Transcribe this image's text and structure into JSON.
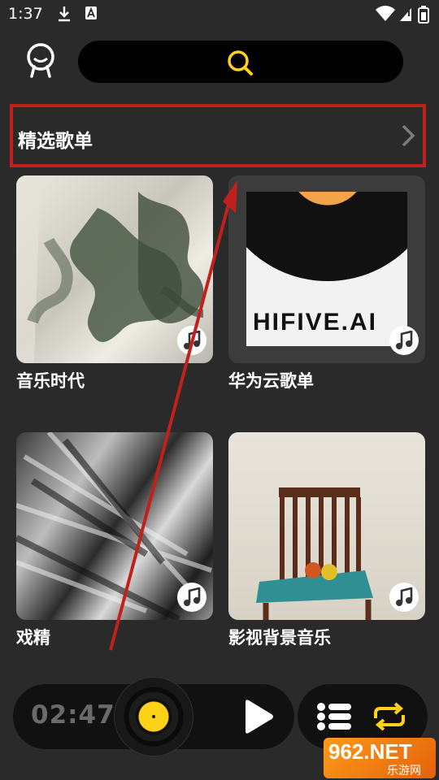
{
  "status_bar": {
    "time": "1:37"
  },
  "section": {
    "title": "精选歌单"
  },
  "playlists": [
    {
      "label": "音乐时代"
    },
    {
      "label": "华为云歌单"
    },
    {
      "label": "戏精"
    },
    {
      "label": "影视背景音乐"
    }
  ],
  "album_text": "HIFIVE.AI",
  "player": {
    "time": "02:47"
  },
  "watermark": {
    "main": "962.NET",
    "sub": "乐游网"
  },
  "colors": {
    "highlight": "#c0211c",
    "accent": "#ffd21a",
    "annotation": "#c0211c"
  }
}
